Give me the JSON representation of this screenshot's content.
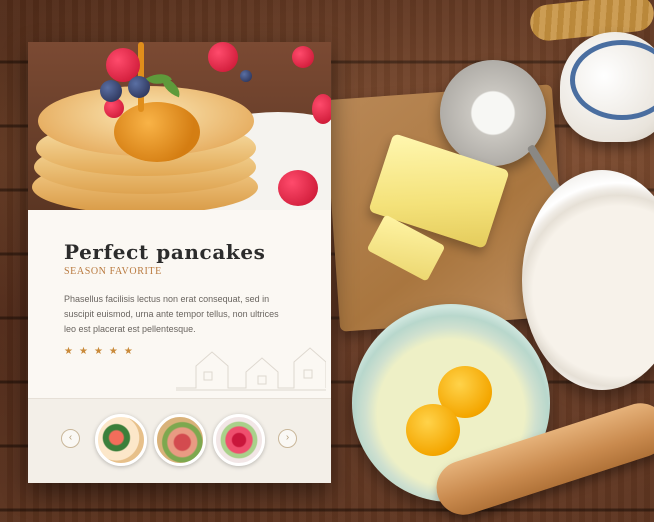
{
  "card": {
    "title": "Perfect pancakes",
    "subtitle": "SEASON FAVORITE",
    "description": "Phasellus facilisis lectus non erat consequat, sed  in suscipit euismod, urna ante tempor tellus, non ultrices leo est placerat est pellentesque.",
    "rating_stars": 5,
    "star_glyph": "★",
    "prev_glyph": "‹",
    "next_glyph": "›",
    "thumbnails": [
      "salad-bowl",
      "ham-dish",
      "raspberry-dessert"
    ]
  },
  "colors": {
    "accent": "#b97a3f",
    "title": "#2c2c2c",
    "card_bg": "#fbf8f3"
  }
}
